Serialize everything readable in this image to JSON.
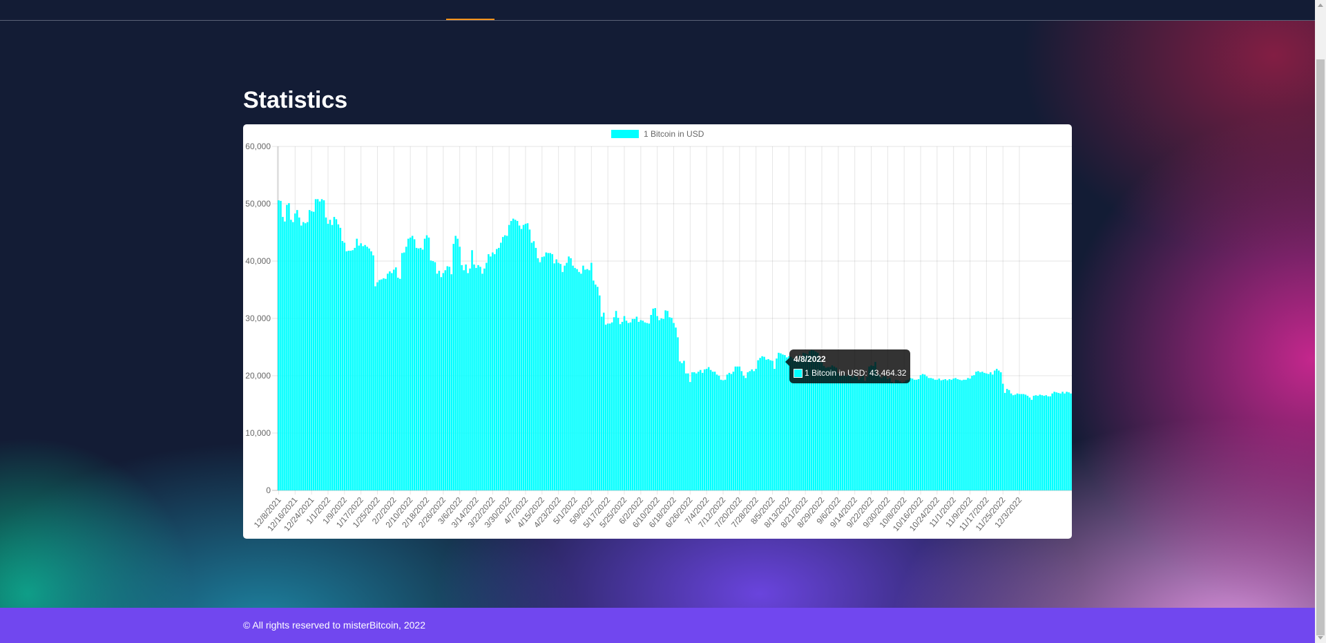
{
  "page": {
    "title": "Statistics",
    "footer_text": "© All rights reserved to misterBitcoin, 2022"
  },
  "colors": {
    "background": "#131c35",
    "bar_fill": "#00ffff",
    "nav_accent": "#f7931a",
    "footer": "#7147ef"
  },
  "tooltip": {
    "title": "4/8/2022",
    "label": "1 Bitcoin in USD: 43,464.32"
  },
  "chart_data": {
    "type": "bar",
    "title": "",
    "xlabel": "",
    "ylabel": "",
    "legend": {
      "position": "top",
      "label": "1 Bitcoin in USD"
    },
    "grid": true,
    "ylim": [
      0,
      60000
    ],
    "yticks": [
      "0",
      "10,000",
      "20,000",
      "30,000",
      "40,000",
      "50,000",
      "60,000"
    ],
    "x_tick_labels": [
      "12/8/2021",
      "12/16/2021",
      "12/24/2021",
      "1/1/2022",
      "1/9/2022",
      "1/17/2022",
      "1/25/2022",
      "2/2/2022",
      "2/10/2022",
      "2/18/2022",
      "2/26/2022",
      "3/6/2022",
      "3/14/2022",
      "3/22/2022",
      "3/30/2022",
      "4/7/2022",
      "4/15/2022",
      "4/23/2022",
      "5/1/2022",
      "5/9/2022",
      "5/17/2022",
      "5/25/2022",
      "6/2/2022",
      "6/10/2022",
      "6/18/2022",
      "6/26/2022",
      "7/4/2022",
      "7/12/2022",
      "7/20/2022",
      "7/28/2022",
      "8/5/2022",
      "8/13/2022",
      "8/21/2022",
      "8/29/2022",
      "9/6/2022",
      "9/14/2022",
      "9/22/2022",
      "9/30/2022",
      "10/8/2022",
      "10/16/2022",
      "10/24/2022",
      "11/1/2022",
      "11/9/2022",
      "11/17/2022",
      "11/25/2022",
      "12/3/2022"
    ],
    "series": [
      {
        "name": "1 Bitcoin in USD",
        "start_date": "12/8/2021",
        "values": [
          50600,
          50500,
          47700,
          46900,
          49800,
          50100,
          47200,
          46800,
          48300,
          48900,
          47600,
          46200,
          46800,
          46600,
          46800,
          48900,
          48700,
          48600,
          50800,
          50800,
          50400,
          50800,
          50600,
          47600,
          46500,
          47200,
          46300,
          47700,
          47300,
          46400,
          45800,
          43500,
          43200,
          41700,
          41800,
          41800,
          41900,
          42300,
          43900,
          42700,
          43100,
          42600,
          42800,
          42500,
          42200,
          41700,
          41000,
          35600,
          36300,
          36700,
          36800,
          37000,
          36900,
          37800,
          38200,
          37900,
          38500,
          38900,
          37100,
          36900,
          41400,
          41500,
          42500,
          43900,
          44100,
          44400,
          43800,
          42300,
          42200,
          42300,
          42000,
          43900,
          44500,
          44100,
          40100,
          40000,
          39800,
          37800,
          38300,
          37200,
          37900,
          38400,
          39100,
          39000,
          37700,
          43000,
          44400,
          43900,
          42500,
          39300,
          38400,
          39400,
          37900,
          38700,
          41900,
          39400,
          38800,
          39300,
          39000,
          37800,
          38700,
          39700,
          41200,
          40800,
          41500,
          41200,
          42100,
          42300,
          43200,
          44200,
          44500,
          44400,
          46300,
          47000,
          47400,
          47200,
          47000,
          46200,
          45600,
          46300,
          46500,
          46600,
          45500,
          43200,
          43464,
          42300,
          40500,
          39800,
          40700,
          40800,
          41500,
          41400,
          41400,
          41200,
          39600,
          40300,
          39700,
          39500,
          38100,
          39200,
          39700,
          40800,
          40500,
          39200,
          38800,
          38600,
          38100,
          37800,
          39200,
          38500,
          38600,
          38400,
          39700,
          36600,
          35900,
          35500,
          34000,
          30300,
          31000,
          28900,
          29100,
          29100,
          29300,
          30200,
          31300,
          30100,
          29000,
          29400,
          30400,
          29600,
          29200,
          29300,
          29900,
          29900,
          30300,
          29400,
          29700,
          29600,
          29300,
          29200,
          29100,
          30600,
          31700,
          31800,
          30400,
          29700,
          30000,
          29900,
          31400,
          31300,
          30200,
          30100,
          29200,
          28400,
          26700,
          22500,
          22200,
          22600,
          20400,
          20400,
          18900,
          20600,
          20600,
          20400,
          20700,
          21000,
          20500,
          21100,
          21200,
          21500,
          21000,
          20700,
          20700,
          20200,
          20000,
          19300,
          19200,
          19300,
          20200,
          20500,
          20300,
          20700,
          21600,
          21600,
          21600,
          20800,
          20000,
          19600,
          20600,
          20800,
          21100,
          20800,
          21200,
          22700,
          23100,
          23400,
          23300,
          22800,
          22900,
          22700,
          22600,
          21200,
          23000,
          24000,
          23900,
          23700,
          23600,
          23200,
          23400,
          23300,
          23000,
          22600,
          22800,
          23600,
          23200,
          24000,
          23900,
          23700,
          24300,
          24500,
          24400,
          24200,
          24000,
          23200,
          22300,
          21700,
          21400,
          21500,
          21500,
          21800,
          21600,
          21400,
          20400,
          19900,
          20000,
          20300,
          19900,
          20100,
          20000,
          19700,
          20100,
          19800,
          19300,
          19700,
          20000,
          19100,
          19800,
          21600,
          21800,
          21700,
          22400,
          20200,
          20200,
          19600,
          19900,
          19900,
          19400,
          19600,
          18900,
          18700,
          19300,
          19200,
          19000,
          18800,
          18900,
          19200,
          19300,
          19600,
          19500,
          19300,
          19300,
          19400,
          20100,
          20300,
          20200,
          19900,
          19600,
          19600,
          19500,
          19300,
          19300,
          19500,
          19200,
          19300,
          19400,
          19200,
          19400,
          19300,
          19500,
          19600,
          19400,
          19300,
          19200,
          19300,
          19300,
          19600,
          19500,
          20000,
          20100,
          20700,
          20800,
          20600,
          20700,
          20500,
          20400,
          20300,
          20600,
          20200,
          20900,
          21200,
          20900,
          20600,
          18600,
          17000,
          17700,
          17500,
          16900,
          16600,
          16700,
          16900,
          16800,
          16800,
          16800,
          16700,
          16500,
          16200,
          15800,
          16500,
          16600,
          16500,
          16700,
          16600,
          16500,
          16600,
          16400,
          16400,
          16900,
          17200,
          17100,
          17000,
          16900,
          17200,
          16900,
          17200,
          17100,
          16900
        ]
      }
    ]
  }
}
